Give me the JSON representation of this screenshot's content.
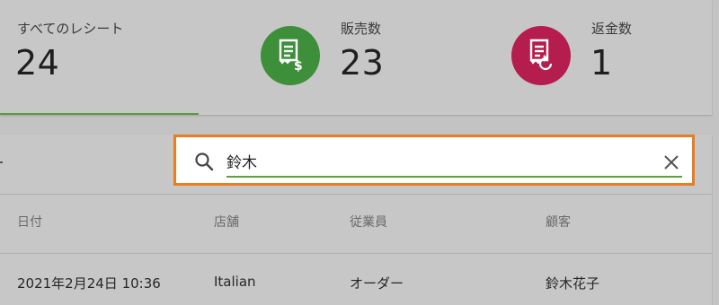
{
  "summary": {
    "all_receipts": {
      "label": "すべてのレシート",
      "value": "24"
    },
    "sales": {
      "label": "販売数",
      "value": "23",
      "icon": "receipt-dollar-icon",
      "color": "#3d8f3a"
    },
    "refunds": {
      "label": "返金数",
      "value": "1",
      "icon": "receipt-refund-icon",
      "color": "#b51d4e"
    }
  },
  "search": {
    "value": "鈴木",
    "highlight_color": "#e97d1f",
    "underline_color": "#5aa23c"
  },
  "table": {
    "headers": [
      "日付",
      "店舗",
      "従業員",
      "顧客"
    ],
    "rows": [
      [
        "2021年2月24日 10:36",
        "Italian",
        "オーダー",
        "鈴木花子"
      ]
    ]
  }
}
